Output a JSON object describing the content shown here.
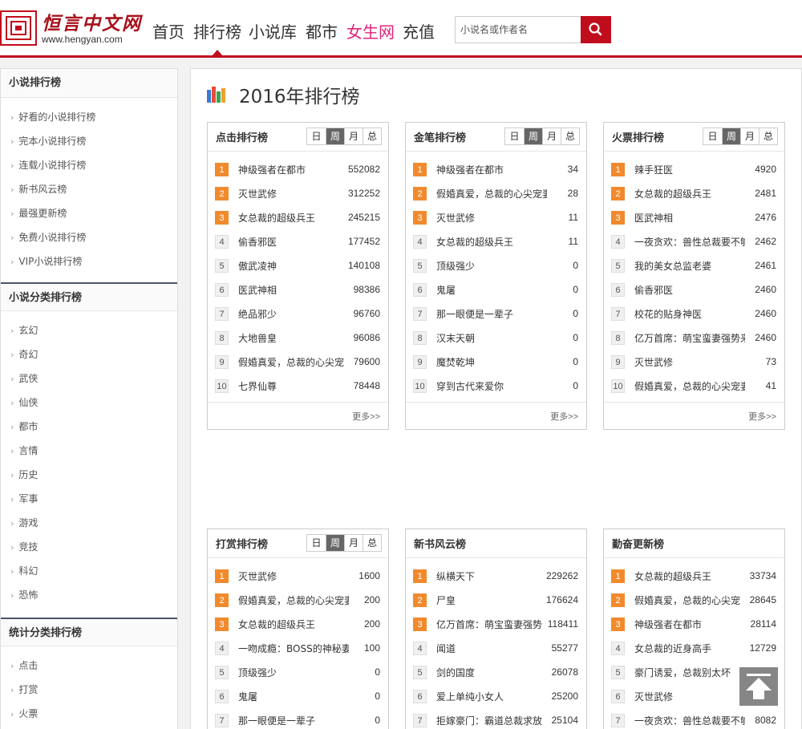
{
  "header": {
    "brand": "恒言中文网",
    "domain": "www.hengyan.com",
    "nav": [
      "首页",
      "排行榜",
      "小说库",
      "都市",
      "女生网",
      "充值"
    ],
    "search_placeholder": "小说名或作者名"
  },
  "sidebar": {
    "sections": [
      {
        "title": "小说排行榜",
        "items": [
          "好看的小说排行榜",
          "完本小说排行榜",
          "连载小说排行榜",
          "新书风云榜",
          "最强更新榜",
          "免费小说排行榜",
          "VIP小说排行榜"
        ]
      },
      {
        "title": "小说分类排行榜",
        "items": [
          "玄幻",
          "奇幻",
          "武侠",
          "仙侠",
          "都市",
          "言情",
          "历史",
          "军事",
          "游戏",
          "竞技",
          "科幻",
          "恐怖"
        ]
      },
      {
        "title": "统计分类排行榜",
        "items": [
          "点击",
          "打赏",
          "火票"
        ]
      }
    ]
  },
  "main": {
    "title": "2016年排行榜",
    "tabs": [
      "日",
      "周",
      "月",
      "总"
    ],
    "more": "更多>>",
    "cards": [
      {
        "title": "点击排行榜",
        "has_tabs": true,
        "rows": [
          {
            "rank": "1",
            "name": "神级强者在都市",
            "value": "552082"
          },
          {
            "rank": "2",
            "name": "灭世武修",
            "value": "312252"
          },
          {
            "rank": "3",
            "name": "女总裁的超级兵王",
            "value": "245215"
          },
          {
            "rank": "4",
            "name": "偷香邪医",
            "value": "177452"
          },
          {
            "rank": "5",
            "name": "傲武凌神",
            "value": "140108"
          },
          {
            "rank": "6",
            "name": "医武神相",
            "value": "98386"
          },
          {
            "rank": "7",
            "name": "绝品邪少",
            "value": "96760"
          },
          {
            "rank": "8",
            "name": "大地兽皇",
            "value": "96086"
          },
          {
            "rank": "9",
            "name": "假婚真爱，总裁的心尖宠",
            "value": "79600"
          },
          {
            "rank": "10",
            "name": "七界仙尊",
            "value": "78448"
          }
        ]
      },
      {
        "title": "金笔排行榜",
        "has_tabs": true,
        "rows": [
          {
            "rank": "1",
            "name": "神级强者在都市",
            "value": "34"
          },
          {
            "rank": "2",
            "name": "假婚真爱，总裁的心尖宠妻",
            "value": "28"
          },
          {
            "rank": "3",
            "name": "灭世武修",
            "value": "11"
          },
          {
            "rank": "4",
            "name": "女总裁的超级兵王",
            "value": "11"
          },
          {
            "rank": "5",
            "name": "顶级强少",
            "value": "0"
          },
          {
            "rank": "6",
            "name": "鬼屠",
            "value": "0"
          },
          {
            "rank": "7",
            "name": "那一眼便是一辈子",
            "value": "0"
          },
          {
            "rank": "8",
            "name": "汉末天朝",
            "value": "0"
          },
          {
            "rank": "9",
            "name": "魔焚乾坤",
            "value": "0"
          },
          {
            "rank": "10",
            "name": "穿到古代来爱你",
            "value": "0"
          }
        ]
      },
      {
        "title": "火票排行榜",
        "has_tabs": true,
        "rows": [
          {
            "rank": "1",
            "name": "辣手狂医",
            "value": "4920"
          },
          {
            "rank": "2",
            "name": "女总裁的超级兵王",
            "value": "2481"
          },
          {
            "rank": "3",
            "name": "医武神相",
            "value": "2476"
          },
          {
            "rank": "4",
            "name": "一夜贪欢：兽性总裁要不够",
            "value": "2462"
          },
          {
            "rank": "5",
            "name": "我的美女总监老婆",
            "value": "2461"
          },
          {
            "rank": "6",
            "name": "偷香邪医",
            "value": "2460"
          },
          {
            "rank": "7",
            "name": "校花的贴身神医",
            "value": "2460"
          },
          {
            "rank": "8",
            "name": "亿万首席：萌宝蛮妻强势来袭",
            "value": "2460"
          },
          {
            "rank": "9",
            "name": "灭世武修",
            "value": "73"
          },
          {
            "rank": "10",
            "name": "假婚真爱，总裁的心尖宠妻",
            "value": "41"
          }
        ]
      },
      {
        "title": "打赏排行榜",
        "has_tabs": true,
        "rows": [
          {
            "rank": "1",
            "name": "灭世武修",
            "value": "1600"
          },
          {
            "rank": "2",
            "name": "假婚真爱，总裁的心尖宠妻",
            "value": "200"
          },
          {
            "rank": "3",
            "name": "女总裁的超级兵王",
            "value": "200"
          },
          {
            "rank": "4",
            "name": "一吻成瘾：BOSS的神秘妻",
            "value": "100"
          },
          {
            "rank": "5",
            "name": "顶级强少",
            "value": "0"
          },
          {
            "rank": "6",
            "name": "鬼屠",
            "value": "0"
          },
          {
            "rank": "7",
            "name": "那一眼便是一辈子",
            "value": "0"
          }
        ]
      },
      {
        "title": "新书风云榜",
        "has_tabs": false,
        "rows": [
          {
            "rank": "1",
            "name": "纵横天下",
            "value": "229262"
          },
          {
            "rank": "2",
            "name": "尸皇",
            "value": "176624"
          },
          {
            "rank": "3",
            "name": "亿万首席：萌宝蛮妻强势",
            "value": "118411"
          },
          {
            "rank": "4",
            "name": "闻道",
            "value": "55277"
          },
          {
            "rank": "5",
            "name": "剑的国度",
            "value": "26078"
          },
          {
            "rank": "6",
            "name": "爱上单纯小女人",
            "value": "25200"
          },
          {
            "rank": "7",
            "name": "拒嫁豪门：霸道总裁求放",
            "value": "25104"
          }
        ]
      },
      {
        "title": "勤奋更新榜",
        "has_tabs": false,
        "rows": [
          {
            "rank": "1",
            "name": "女总裁的超级兵王",
            "value": "33734"
          },
          {
            "rank": "2",
            "name": "假婚真爱，总裁的心尖宠",
            "value": "28645"
          },
          {
            "rank": "3",
            "name": "神级强者在都市",
            "value": "28114"
          },
          {
            "rank": "4",
            "name": "女总裁的近身高手",
            "value": "12729"
          },
          {
            "rank": "5",
            "name": "豪门诱爱，总裁别太坏",
            "value": ""
          },
          {
            "rank": "6",
            "name": "灭世武修",
            "value": ""
          },
          {
            "rank": "7",
            "name": "一夜贪欢：兽性总裁要不够",
            "value": "8082"
          }
        ]
      }
    ]
  },
  "colors": {
    "accent": "#c00d1e",
    "rank_top": "#f18a2d",
    "female_nav": "#e0247a"
  },
  "icons": {
    "search": "search-icon",
    "back_to_top": "back-to-top-icon",
    "title": "bar-chart-icon"
  }
}
